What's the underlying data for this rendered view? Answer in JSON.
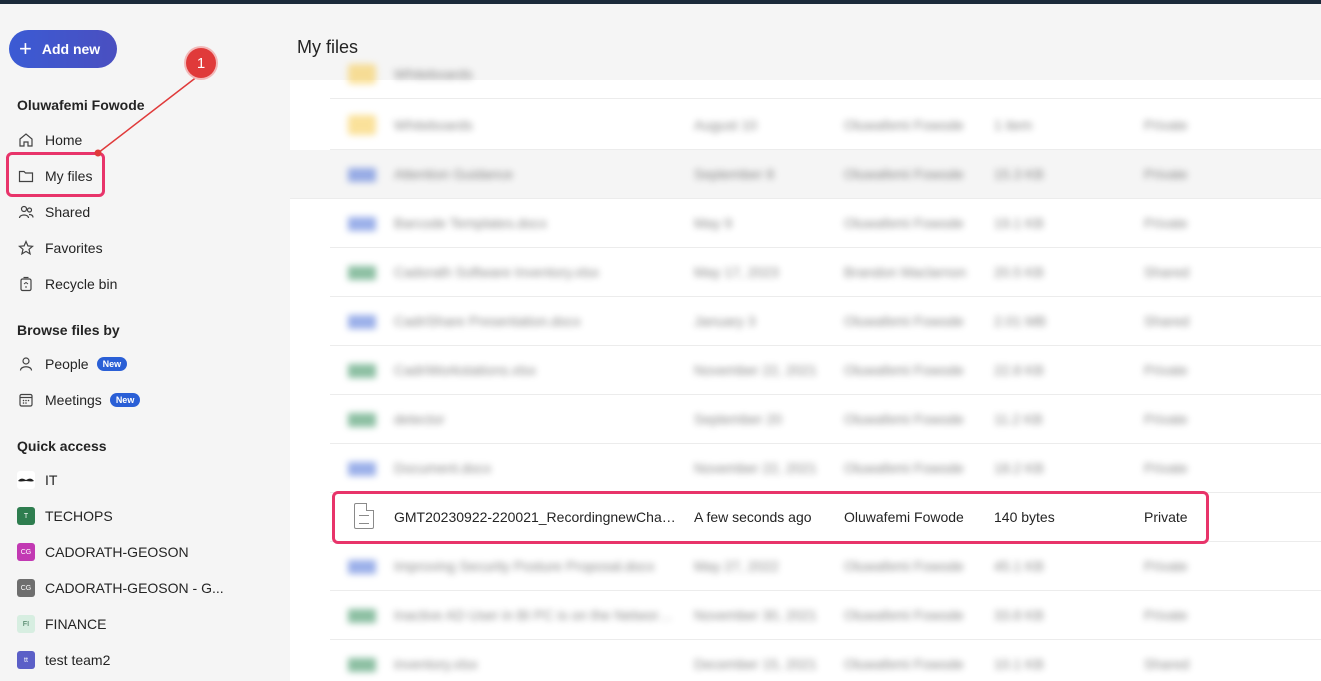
{
  "sidebar": {
    "add_new_label": "Add new",
    "user_name": "Oluwafemi Fowode",
    "nav": [
      {
        "label": "Home",
        "icon": "home-icon"
      },
      {
        "label": "My files",
        "icon": "folder-icon"
      },
      {
        "label": "Shared",
        "icon": "people-icon"
      },
      {
        "label": "Favorites",
        "icon": "star-icon"
      },
      {
        "label": "Recycle bin",
        "icon": "recycle-bin-icon"
      }
    ],
    "browse_title": "Browse files by",
    "browse": [
      {
        "label": "People",
        "badge": "New"
      },
      {
        "label": "Meetings",
        "badge": "New"
      }
    ],
    "quick_access_title": "Quick access",
    "quick_access": [
      {
        "label": "IT",
        "abbr": "",
        "color": "#222222"
      },
      {
        "label": "TECHOPS",
        "abbr": "T",
        "color": "#2e7d4f"
      },
      {
        "label": "CADORATH-GEOSON",
        "abbr": "CG",
        "color": "#c239b3"
      },
      {
        "label": "CADORATH-GEOSON - G...",
        "abbr": "CG",
        "color": "#6e6e6e"
      },
      {
        "label": "FINANCE",
        "abbr": "FI",
        "color": "#d7eee1"
      },
      {
        "label": "test team2",
        "abbr": "tt",
        "color": "#5b5fc7"
      }
    ]
  },
  "annotation": {
    "step": "1"
  },
  "main": {
    "title": "My files",
    "highlighted_file": {
      "name": "GMT20230922-220021_RecordingnewChat....",
      "modified": "A few seconds ago",
      "owner": "Oluwafemi Fowode",
      "size": "140 bytes",
      "sharing": "Private"
    },
    "blurred_rows": [
      {
        "name": "Whiteboards",
        "modified": "August 10",
        "owner": "Oluwafemi Fowode",
        "size": "1 item",
        "sharing": "Private",
        "type": "folder"
      },
      {
        "name": "Attention Guidance",
        "modified": "September 8",
        "owner": "Oluwafemi Fowode",
        "size": "15.3 KB",
        "sharing": "Private",
        "type": "doc"
      },
      {
        "name": "Barcode Templates.docx",
        "modified": "May 9",
        "owner": "Oluwafemi Fowode",
        "size": "19.1 KB",
        "sharing": "Private",
        "type": "doc"
      },
      {
        "name": "Cadorath Software Inventory.xlsx",
        "modified": "May 17, 2023",
        "owner": "Brandon Maclarnon",
        "size": "20.5 KB",
        "sharing": "Shared",
        "type": "xls"
      },
      {
        "name": "CadriShare Presentation.docx",
        "modified": "January 3",
        "owner": "Oluwafemi Fowode",
        "size": "2.01 MB",
        "sharing": "Shared",
        "type": "doc"
      },
      {
        "name": "CadriWorkstations.xlsx",
        "modified": "November 22, 2021",
        "owner": "Oluwafemi Fowode",
        "size": "22.8 KB",
        "sharing": "Private",
        "type": "xls"
      },
      {
        "name": "detector",
        "modified": "September 20",
        "owner": "Oluwafemi Fowode",
        "size": "11.2 KB",
        "sharing": "Private",
        "type": "xls"
      },
      {
        "name": "Document.docx",
        "modified": "November 22, 2021",
        "owner": "Oluwafemi Fowode",
        "size": "18.2 KB",
        "sharing": "Private",
        "type": "doc"
      },
      {
        "name": "Improving Security Posture Proposal.docx",
        "modified": "May 27, 2022",
        "owner": "Oluwafemi Fowode",
        "size": "45.1 KB",
        "sharing": "Private",
        "type": "doc"
      },
      {
        "name": "Inactive AD User in BI PC is on the Networks.x...",
        "modified": "November 30, 2021",
        "owner": "Oluwafemi Fowode",
        "size": "33.8 KB",
        "sharing": "Private",
        "type": "xls"
      },
      {
        "name": "inventory.xlsx",
        "modified": "December 15, 2021",
        "owner": "Oluwafemi Fowode",
        "size": "10.1 KB",
        "sharing": "Shared",
        "type": "xls"
      }
    ]
  }
}
